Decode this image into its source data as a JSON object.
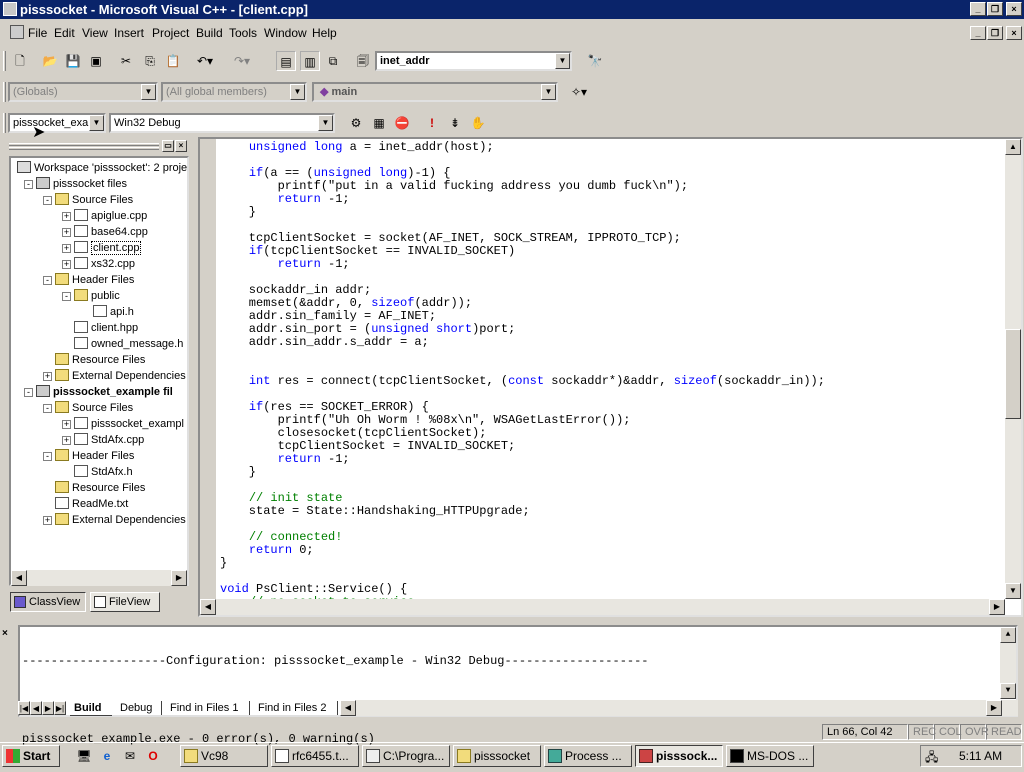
{
  "window": {
    "title": "pisssocket - Microsoft Visual C++ - [client.cpp]"
  },
  "menu": [
    "File",
    "Edit",
    "View",
    "Insert",
    "Project",
    "Build",
    "Tools",
    "Window",
    "Help"
  ],
  "toolbar": {
    "find_combo": "inet_addr",
    "scope_combo": "(Globals)",
    "members_combo": "(All global members)",
    "function_combo": "main",
    "project_combo": "pisssocket_exan",
    "config_combo": "Win32 Debug"
  },
  "workspace": {
    "tree": [
      {
        "label": "Workspace 'pisssocket': 2 proje",
        "type": "ws",
        "level": 0
      },
      {
        "label": "pisssocket files",
        "type": "proj",
        "level": 1,
        "exp": "-"
      },
      {
        "label": "Source Files",
        "type": "fold",
        "level": 2,
        "exp": "-"
      },
      {
        "label": "apiglue.cpp",
        "type": "file",
        "level": 3,
        "exp": "+"
      },
      {
        "label": "base64.cpp",
        "type": "file",
        "level": 3,
        "exp": "+"
      },
      {
        "label": "client.cpp",
        "type": "file",
        "level": 3,
        "exp": "+",
        "selected": true
      },
      {
        "label": "xs32.cpp",
        "type": "file",
        "level": 3,
        "exp": "+"
      },
      {
        "label": "Header Files",
        "type": "fold",
        "level": 2,
        "exp": "-"
      },
      {
        "label": "public",
        "type": "fold",
        "level": 3,
        "exp": "-"
      },
      {
        "label": "api.h",
        "type": "file",
        "level": 4
      },
      {
        "label": "client.hpp",
        "type": "file",
        "level": 3
      },
      {
        "label": "owned_message.h",
        "type": "file",
        "level": 3
      },
      {
        "label": "Resource Files",
        "type": "fold",
        "level": 2
      },
      {
        "label": "External Dependencies",
        "type": "fold",
        "level": 2,
        "exp": "+"
      },
      {
        "label": "pisssocket_example fil",
        "type": "proj",
        "level": 1,
        "exp": "-",
        "bold": true
      },
      {
        "label": "Source Files",
        "type": "fold",
        "level": 2,
        "exp": "-"
      },
      {
        "label": "pisssocket_exampl",
        "type": "file",
        "level": 3,
        "exp": "+"
      },
      {
        "label": "StdAfx.cpp",
        "type": "file",
        "level": 3,
        "exp": "+"
      },
      {
        "label": "Header Files",
        "type": "fold",
        "level": 2,
        "exp": "-"
      },
      {
        "label": "StdAfx.h",
        "type": "file",
        "level": 3
      },
      {
        "label": "Resource Files",
        "type": "fold",
        "level": 2
      },
      {
        "label": "ReadMe.txt",
        "type": "file",
        "level": 2
      },
      {
        "label": "External Dependencies",
        "type": "fold",
        "level": 2,
        "exp": "+"
      }
    ],
    "tabs": [
      "ClassView",
      "FileView"
    ]
  },
  "code": [
    [
      [
        "    ",
        ""
      ],
      [
        "unsigned long",
        "kw"
      ],
      [
        " a = inet_addr(host);",
        ""
      ]
    ],
    [
      [
        "",
        ""
      ]
    ],
    [
      [
        "    ",
        ""
      ],
      [
        "if",
        "kw"
      ],
      [
        "(a == (",
        ""
      ],
      [
        "unsigned long",
        "kw"
      ],
      [
        ")-1) {",
        ""
      ]
    ],
    [
      [
        "        printf(\"put in a valid fucking address you dumb fuck\\n\");",
        ""
      ]
    ],
    [
      [
        "        ",
        ""
      ],
      [
        "return",
        "kw"
      ],
      [
        " -1;",
        ""
      ]
    ],
    [
      [
        "    }",
        ""
      ]
    ],
    [
      [
        "",
        ""
      ]
    ],
    [
      [
        "    tcpClientSocket = socket(AF_INET, SOCK_STREAM, IPPROTO_TCP);",
        ""
      ]
    ],
    [
      [
        "    ",
        ""
      ],
      [
        "if",
        "kw"
      ],
      [
        "(tcpClientSocket == INVALID_SOCKET)",
        ""
      ]
    ],
    [
      [
        "        ",
        ""
      ],
      [
        "return",
        "kw"
      ],
      [
        " -1;",
        ""
      ]
    ],
    [
      [
        "",
        ""
      ]
    ],
    [
      [
        "    sockaddr_in addr;",
        ""
      ]
    ],
    [
      [
        "    memset(&addr, 0, ",
        ""
      ],
      [
        "sizeof",
        "kw"
      ],
      [
        "(addr));",
        ""
      ]
    ],
    [
      [
        "    addr.sin_family = AF_INET;",
        ""
      ]
    ],
    [
      [
        "    addr.sin_port = (",
        ""
      ],
      [
        "unsigned short",
        "kw"
      ],
      [
        ")port;",
        ""
      ]
    ],
    [
      [
        "    addr.sin_addr.s_addr = a;",
        ""
      ]
    ],
    [
      [
        "",
        ""
      ]
    ],
    [
      [
        "",
        ""
      ]
    ],
    [
      [
        "    ",
        ""
      ],
      [
        "int",
        "kw"
      ],
      [
        " res = connect(tcpClientSocket, (",
        ""
      ],
      [
        "const",
        "kw"
      ],
      [
        " sockaddr*)&addr, ",
        ""
      ],
      [
        "sizeof",
        "kw"
      ],
      [
        "(sockaddr_in));",
        ""
      ]
    ],
    [
      [
        "",
        ""
      ]
    ],
    [
      [
        "    ",
        ""
      ],
      [
        "if",
        "kw"
      ],
      [
        "(res == SOCKET_ERROR) {",
        ""
      ]
    ],
    [
      [
        "        printf(\"Uh Oh Worm ! %08x\\n\", WSAGetLastError());",
        ""
      ]
    ],
    [
      [
        "        closesocket(tcpClientSocket);",
        ""
      ]
    ],
    [
      [
        "        tcpClientSocket = INVALID_SOCKET;",
        ""
      ]
    ],
    [
      [
        "        ",
        ""
      ],
      [
        "return",
        "kw"
      ],
      [
        " -1;",
        ""
      ]
    ],
    [
      [
        "    }",
        ""
      ]
    ],
    [
      [
        "",
        ""
      ]
    ],
    [
      [
        "    ",
        ""
      ],
      [
        "// init state",
        "cm"
      ]
    ],
    [
      [
        "    state = State::Handshaking_HTTPUpgrade;",
        ""
      ]
    ],
    [
      [
        "",
        ""
      ]
    ],
    [
      [
        "    ",
        ""
      ],
      [
        "// connected!",
        "cm"
      ]
    ],
    [
      [
        "    ",
        ""
      ],
      [
        "return",
        "kw"
      ],
      [
        " 0;",
        ""
      ]
    ],
    [
      [
        "}",
        ""
      ]
    ],
    [
      [
        "",
        ""
      ]
    ],
    [
      [
        "",
        ""
      ],
      [
        "void",
        "kw"
      ],
      [
        " PsClient::Service() {",
        ""
      ]
    ],
    [
      [
        "    ",
        ""
      ],
      [
        "// no socket to service",
        "cm"
      ]
    ]
  ],
  "output": {
    "lines": [
      "--------------------Configuration: pisssocket_example - Win32 Debug--------------------",
      "",
      "pisssocket_example.exe - 0 error(s), 0 warning(s)"
    ],
    "tabs": [
      "Build",
      "Debug",
      "Find in Files 1",
      "Find in Files 2"
    ]
  },
  "status": {
    "position": "Ln 66, Col 42",
    "indicators": [
      "REC",
      "COL",
      "OVR",
      "READ"
    ]
  },
  "taskbar": {
    "start": "Start",
    "items": [
      "Vc98",
      "rfc6455.t...",
      "C:\\Progra...",
      "pisssocket",
      "Process ...",
      "pisssock...",
      "MS-DOS ..."
    ],
    "active_index": 5,
    "clock": "5:11 AM"
  }
}
